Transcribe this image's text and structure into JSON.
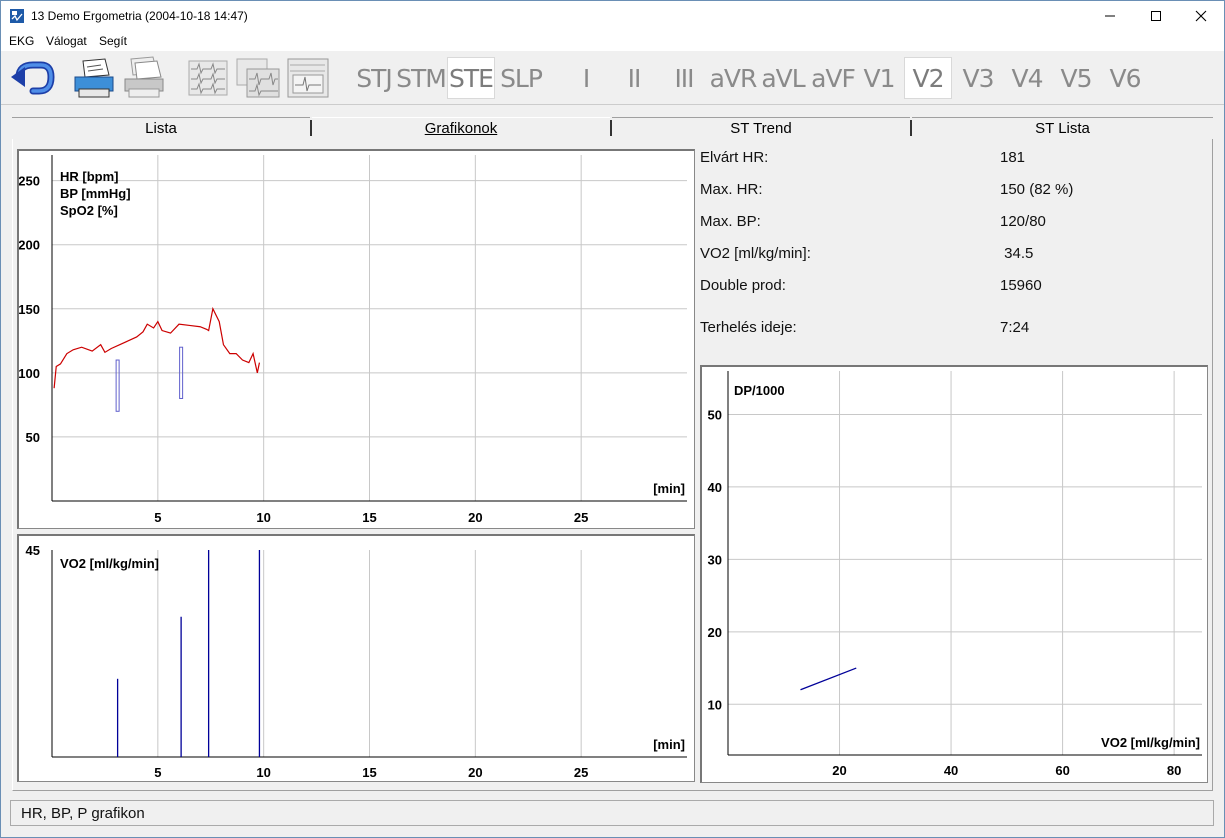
{
  "window": {
    "title": "13 Demo Ergometria (2004-10-18 14:47)"
  },
  "menu": {
    "items": [
      "EKG",
      "Válogat",
      "Segít"
    ]
  },
  "leads": [
    "STJ",
    "STM",
    "STE",
    "SLP",
    "I",
    "II",
    "III",
    "aVR",
    "aVL",
    "aVF",
    "V1",
    "V2",
    "V3",
    "V4",
    "V5",
    "V6"
  ],
  "selected_leads": [
    "STE",
    "V2"
  ],
  "toolbar_icons": [
    "back-arrow-icon",
    "print-icon",
    "print-all-icon",
    "ecg-grid-icon",
    "ecg-multi-icon",
    "ecg-detail-icon"
  ],
  "tabs": [
    "Lista",
    "Grafikonok",
    "ST Trend",
    "ST Lista"
  ],
  "active_tab": "Grafikonok",
  "info": {
    "rows": [
      {
        "label": "Elvárt HR:",
        "value": "181"
      },
      {
        "label": "Max. HR:",
        "value": "150 (82 %)"
      },
      {
        "label": "Max. BP:",
        "value": "120/80"
      },
      {
        "label": "VO2 [ml/kg/min]:",
        "value": " 34.5"
      },
      {
        "label": "Double prod:",
        "value": "15960"
      },
      {
        "label": "Terhelés ideje:",
        "value": "7:24"
      }
    ]
  },
  "status": "HR, BP, P grafikon",
  "colors": {
    "hr_line": "#cc0000",
    "bp_box": "#6060cc",
    "vo2_line": "#000099",
    "grid": "#c8c8c8"
  },
  "chart_data": [
    {
      "type": "line",
      "legend": [
        "HR [bpm]",
        "BP [mmHg]",
        "SpO2 [%]"
      ],
      "xlabel": "[min]",
      "xlim": [
        0,
        30
      ],
      "ylim": [
        0,
        270
      ],
      "x_ticks": [
        5,
        10,
        15,
        20,
        25
      ],
      "y_ticks": [
        50,
        100,
        150,
        200,
        250
      ],
      "series": [
        {
          "name": "HR [bpm]",
          "x": [
            0.1,
            0.2,
            0.4,
            0.7,
            1.0,
            1.4,
            1.9,
            2.3,
            2.5,
            2.8,
            3.2,
            3.6,
            4.0,
            4.3,
            4.5,
            4.8,
            5.0,
            5.2,
            5.6,
            6.0,
            6.5,
            7.0,
            7.3,
            7.4,
            7.6,
            7.9,
            8.1,
            8.4,
            8.7,
            9.0,
            9.3,
            9.5,
            9.7,
            9.8
          ],
          "y": [
            88,
            105,
            107,
            115,
            118,
            120,
            117,
            122,
            116,
            119,
            122,
            125,
            128,
            132,
            138,
            135,
            140,
            133,
            131,
            138,
            137,
            136,
            134,
            133,
            150,
            140,
            122,
            115,
            115,
            110,
            108,
            115,
            100,
            108
          ]
        }
      ],
      "bp": [
        {
          "x": 3.1,
          "sys": 110,
          "dia": 70
        },
        {
          "x": 6.1,
          "sys": 120,
          "dia": 80
        }
      ]
    },
    {
      "type": "bar",
      "title": "VO2 [ml/kg/min]",
      "xlabel": "[min]",
      "xlim": [
        0,
        30
      ],
      "ylim": [
        0,
        45
      ],
      "x_ticks": [
        5,
        10,
        15,
        20,
        25
      ],
      "y_ticks": [
        45
      ],
      "x": [
        3.1,
        6.1,
        7.4,
        9.8
      ],
      "values": [
        17,
        30.5,
        45,
        45
      ]
    },
    {
      "type": "line",
      "title": "DP/1000",
      "xlabel": "VO2 [ml/kg/min]",
      "xlim": [
        0,
        85
      ],
      "ylim": [
        3,
        56
      ],
      "x_ticks": [
        20,
        40,
        60,
        80
      ],
      "y_ticks": [
        10,
        20,
        30,
        40,
        50
      ],
      "series": [
        {
          "x": [
            13,
            23
          ],
          "y": [
            12,
            15
          ]
        }
      ]
    }
  ]
}
